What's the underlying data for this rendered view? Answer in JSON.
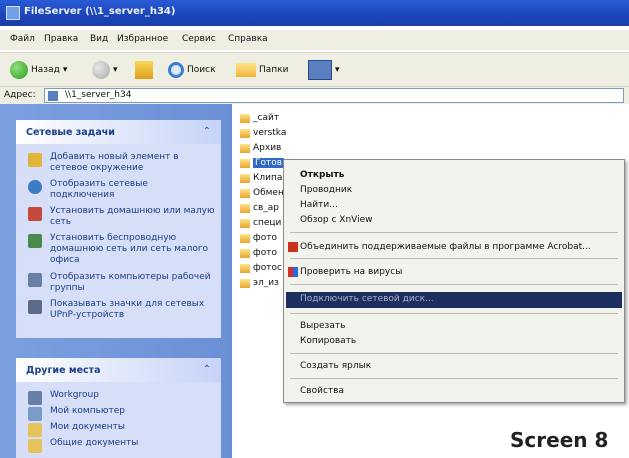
{
  "window": {
    "title": "FileServer (\\\\1_server_h34)"
  },
  "menu": [
    "Файл",
    "Правка",
    "Вид",
    "Избранное",
    "Сервис",
    "Справка"
  ],
  "toolbar": {
    "back": "Назад",
    "search": "Поиск",
    "folders": "Папки"
  },
  "address": {
    "label": "Адрес:",
    "value": "\\\\1_server_h34"
  },
  "network_tasks": {
    "title": "Сетевые задачи",
    "items": [
      "Добавить новый элемент в сетевое окружение",
      "Отобразить сетевые подключения",
      "Установить домашнюю или малую сеть",
      "Установить беспроводную домашнюю сеть или сеть малого офиса",
      "Отобразить компьютеры рабочей группы",
      "Показывать значки для сетевых UPnP-устройств"
    ]
  },
  "other_places": {
    "title": "Другие места",
    "items": [
      "Workgroup",
      "Мой компьютер",
      "Мои документы",
      "Общие документы"
    ]
  },
  "files": [
    "_сайт",
    "verstka",
    "Архив",
    "Готов",
    "Клипа",
    "Обмен",
    "св_ар",
    "специ",
    "фото",
    "фото",
    "фотос",
    "эл_из"
  ],
  "context_menu": {
    "open": "Открыть",
    "explorer": "Проводник",
    "find": "Найти...",
    "xnview": "Обзор с XnView",
    "acrobat": "Объединить поддерживаемые файлы в программе Acrobat...",
    "scan": "Проверить на вирусы",
    "map_drive": "Подключить сетевой диск...",
    "cut": "Вырезать",
    "copy": "Копировать",
    "shortcut": "Создать ярлык",
    "properties": "Свойства"
  },
  "caption": "Screen 8"
}
